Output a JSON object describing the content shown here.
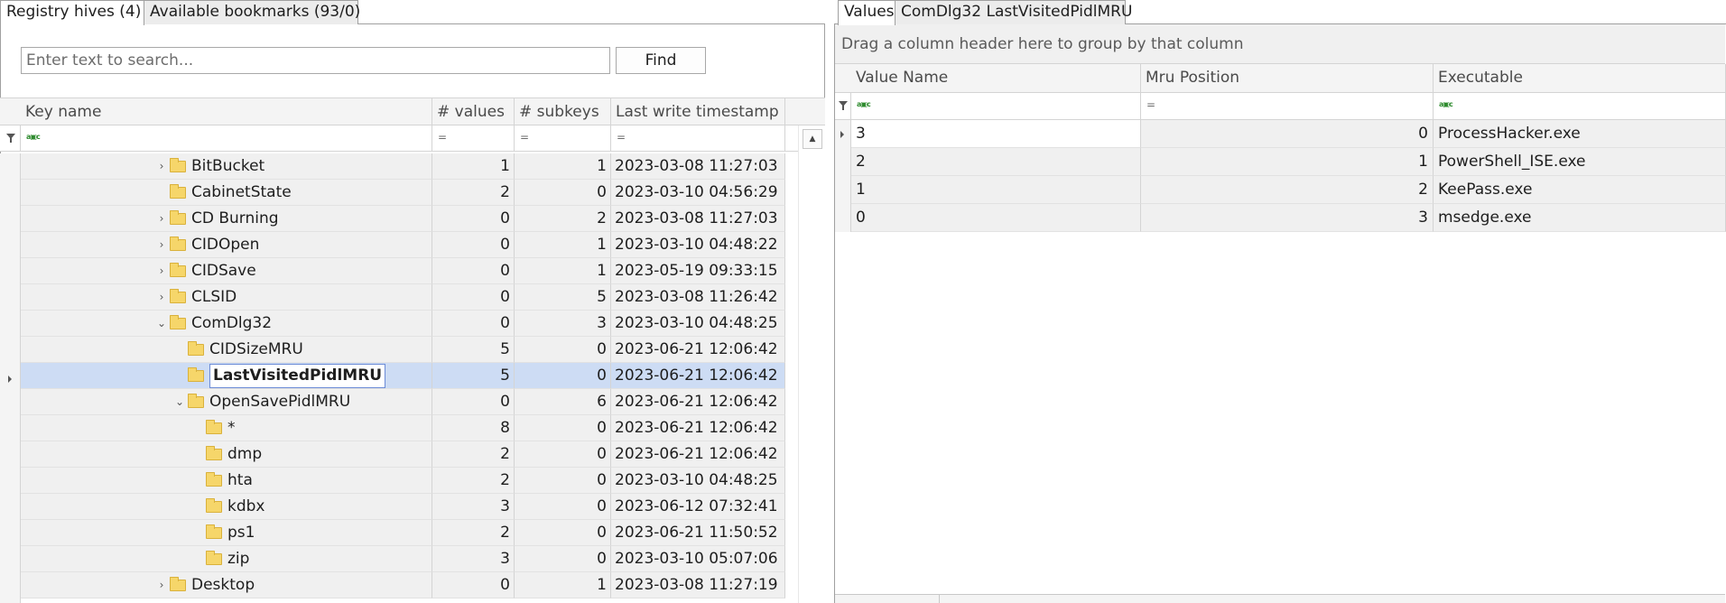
{
  "left_tabs": [
    "Registry hives (4)",
    "Available bookmarks (93/0)"
  ],
  "search": {
    "placeholder": "Enter text to search...",
    "button_label": "Find"
  },
  "tree_columns": [
    "Key name",
    "# values",
    "# subkeys",
    "Last write timestamp"
  ],
  "tree_rows": [
    {
      "name": "BitBucket",
      "values": "1",
      "subkeys": "1",
      "timestamp": "2023-03-08 11:27:03",
      "level": 0,
      "expander": "collapsed",
      "selected": false
    },
    {
      "name": "CabinetState",
      "values": "2",
      "subkeys": "0",
      "timestamp": "2023-03-10 04:56:29",
      "level": 0,
      "expander": "none",
      "selected": false
    },
    {
      "name": "CD Burning",
      "values": "0",
      "subkeys": "2",
      "timestamp": "2023-03-08 11:27:03",
      "level": 0,
      "expander": "collapsed",
      "selected": false
    },
    {
      "name": "CIDOpen",
      "values": "0",
      "subkeys": "1",
      "timestamp": "2023-03-10 04:48:22",
      "level": 0,
      "expander": "collapsed",
      "selected": false
    },
    {
      "name": "CIDSave",
      "values": "0",
      "subkeys": "1",
      "timestamp": "2023-05-19 09:33:15",
      "level": 0,
      "expander": "collapsed",
      "selected": false
    },
    {
      "name": "CLSID",
      "values": "0",
      "subkeys": "5",
      "timestamp": "2023-03-08 11:26:42",
      "level": 0,
      "expander": "collapsed",
      "selected": false
    },
    {
      "name": "ComDlg32",
      "values": "0",
      "subkeys": "3",
      "timestamp": "2023-03-10 04:48:25",
      "level": 0,
      "expander": "expanded",
      "selected": false
    },
    {
      "name": "CIDSizeMRU",
      "values": "5",
      "subkeys": "0",
      "timestamp": "2023-06-21 12:06:42",
      "level": 1,
      "expander": "none",
      "selected": false
    },
    {
      "name": "LastVisitedPidlMRU",
      "values": "5",
      "subkeys": "0",
      "timestamp": "2023-06-21 12:06:42",
      "level": 1,
      "expander": "none",
      "selected": true
    },
    {
      "name": "OpenSavePidlMRU",
      "values": "0",
      "subkeys": "6",
      "timestamp": "2023-06-21 12:06:42",
      "level": 1,
      "expander": "expanded",
      "selected": false
    },
    {
      "name": "*",
      "values": "8",
      "subkeys": "0",
      "timestamp": "2023-06-21 12:06:42",
      "level": 2,
      "expander": "none",
      "selected": false
    },
    {
      "name": "dmp",
      "values": "2",
      "subkeys": "0",
      "timestamp": "2023-06-21 12:06:42",
      "level": 2,
      "expander": "none",
      "selected": false
    },
    {
      "name": "hta",
      "values": "2",
      "subkeys": "0",
      "timestamp": "2023-03-10 04:48:25",
      "level": 2,
      "expander": "none",
      "selected": false
    },
    {
      "name": "kdbx",
      "values": "3",
      "subkeys": "0",
      "timestamp": "2023-06-12 07:32:41",
      "level": 2,
      "expander": "none",
      "selected": false
    },
    {
      "name": "ps1",
      "values": "2",
      "subkeys": "0",
      "timestamp": "2023-06-21 11:50:52",
      "level": 2,
      "expander": "none",
      "selected": false
    },
    {
      "name": "zip",
      "values": "3",
      "subkeys": "0",
      "timestamp": "2023-03-10 05:07:06",
      "level": 2,
      "expander": "none",
      "selected": false
    },
    {
      "name": "Desktop",
      "values": "0",
      "subkeys": "1",
      "timestamp": "2023-03-08 11:27:19",
      "level": 0,
      "expander": "collapsed",
      "selected": false
    }
  ],
  "right_tabs": [
    "Values",
    "ComDlg32 LastVisitedPidlMRU"
  ],
  "group_hint": "Drag a column header here to group by that column",
  "value_columns": [
    "Value Name",
    "Mru Position",
    "Executable"
  ],
  "value_rows": [
    {
      "value_name": "3",
      "mru_position": "0",
      "executable": "ProcessHacker.exe"
    },
    {
      "value_name": "2",
      "mru_position": "1",
      "executable": "PowerShell_ISE.exe"
    },
    {
      "value_name": "1",
      "mru_position": "2",
      "executable": "KeePass.exe"
    },
    {
      "value_name": "0",
      "mru_position": "3",
      "executable": "msedge.exe"
    }
  ],
  "filter_symbols": {
    "equals": "=",
    "contains_icon": "abc-filter-icon"
  },
  "icons": [
    "funnel-icon",
    "folder-icon",
    "chevron-right-icon",
    "chevron-down-icon",
    "row-indicator-icon",
    "scroll-up-icon"
  ],
  "colors": {
    "selection": "#cddcf4",
    "folder": "#f6d66a",
    "header_bg": "#f4f4f4"
  }
}
